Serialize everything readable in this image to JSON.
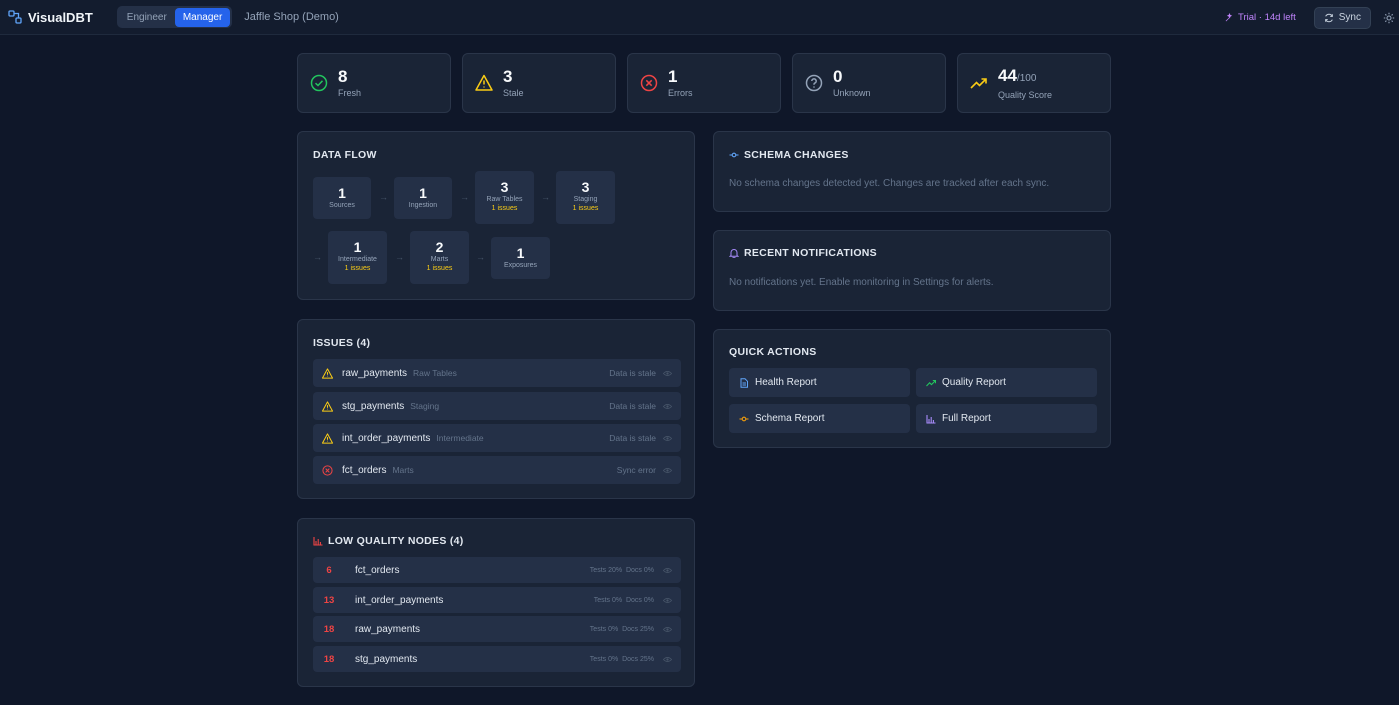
{
  "app": {
    "name": "VisualDBT",
    "project": "Jaffle Shop (Demo)"
  },
  "modes": [
    {
      "label": "Engineer"
    },
    {
      "label": "Manager"
    }
  ],
  "topbar": {
    "trial": "Trial · 14d left",
    "sync": "Sync"
  },
  "stats": [
    {
      "value": "8",
      "label": "Fresh",
      "icon": "check-circle-icon",
      "color": "#22c55e"
    },
    {
      "value": "3",
      "label": "Stale",
      "icon": "warning-icon",
      "color": "#facc15"
    },
    {
      "value": "1",
      "label": "Errors",
      "icon": "x-circle-icon",
      "color": "#ef4444"
    },
    {
      "value": "0",
      "label": "Unknown",
      "icon": "help-circle-icon",
      "color": "#94a3b8"
    },
    {
      "value": "44",
      "suffix": "/100",
      "label": "Quality Score",
      "icon": "trending-up-icon",
      "color": "#facc15"
    }
  ],
  "dataflow": {
    "title": "DATA FLOW",
    "nodes": [
      {
        "count": "1",
        "label": "Sources",
        "issues": ""
      },
      {
        "count": "1",
        "label": "Ingestion",
        "issues": ""
      },
      {
        "count": "3",
        "label": "Raw Tables",
        "issues": "1 issues"
      },
      {
        "count": "3",
        "label": "Staging",
        "issues": "1 issues"
      },
      {
        "count": "1",
        "label": "Intermediate",
        "issues": "1 issues"
      },
      {
        "count": "2",
        "label": "Marts",
        "issues": "1 issues"
      },
      {
        "count": "1",
        "label": "Exposures",
        "issues": ""
      }
    ],
    "arrow": "→"
  },
  "issues": {
    "title": "ISSUES (4)",
    "rows": [
      {
        "name": "raw_payments",
        "layer": "Raw Tables",
        "status": "Data is stale",
        "kind": "warning"
      },
      {
        "name": "stg_payments",
        "layer": "Staging",
        "status": "Data is stale",
        "kind": "warning"
      },
      {
        "name": "int_order_payments",
        "layer": "Intermediate",
        "status": "Data is stale",
        "kind": "warning"
      },
      {
        "name": "fct_orders",
        "layer": "Marts",
        "status": "Sync error",
        "kind": "error"
      }
    ]
  },
  "low_quality": {
    "title": "LOW QUALITY NODES (4)",
    "rows": [
      {
        "score": "6",
        "name": "fct_orders",
        "tests": "Tests 20%",
        "docs": "Docs 0%"
      },
      {
        "score": "13",
        "name": "int_order_payments",
        "tests": "Tests 0%",
        "docs": "Docs 0%"
      },
      {
        "score": "18",
        "name": "raw_payments",
        "tests": "Tests 0%",
        "docs": "Docs 25%"
      },
      {
        "score": "18",
        "name": "stg_payments",
        "tests": "Tests 0%",
        "docs": "Docs 25%"
      }
    ]
  },
  "schema_changes": {
    "title": "SCHEMA CHANGES",
    "empty": "No schema changes detected yet. Changes are tracked after each sync."
  },
  "notifications": {
    "title": "RECENT NOTIFICATIONS",
    "empty": "No notifications yet. Enable monitoring in Settings for alerts."
  },
  "quick_actions": {
    "title": "QUICK ACTIONS",
    "buttons": [
      {
        "label": "Health Report",
        "icon": "file-text-icon",
        "color": "#60a5fa"
      },
      {
        "label": "Quality Report",
        "icon": "trending-up-icon",
        "color": "#22c55e"
      },
      {
        "label": "Schema Report",
        "icon": "git-commit-icon",
        "color": "#f59e0b"
      },
      {
        "label": "Full Report",
        "icon": "bar-chart-icon",
        "color": "#a78bfa"
      }
    ]
  }
}
